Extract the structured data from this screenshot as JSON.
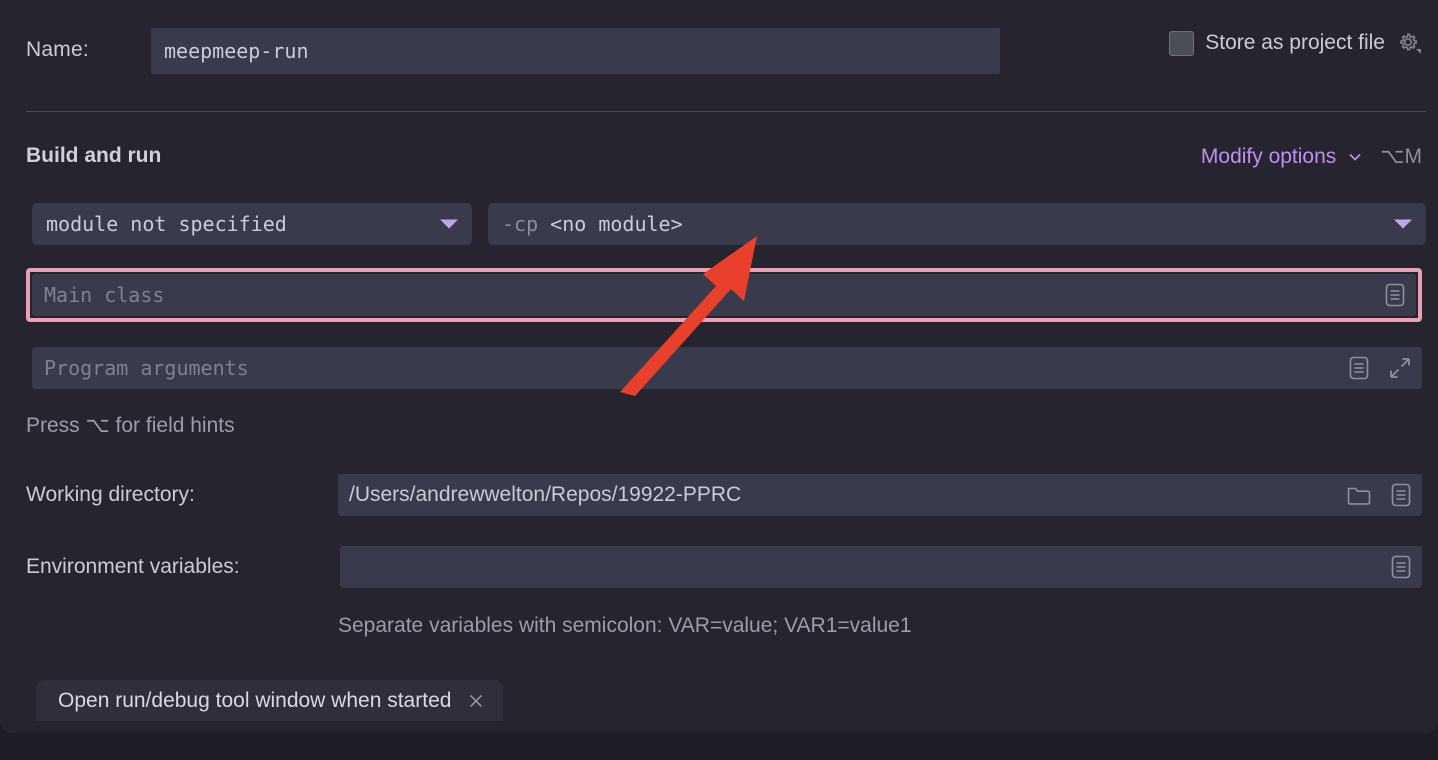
{
  "dialog": {
    "name_row": {
      "label": "Name:",
      "value": "meepmeep-run",
      "store_as_project_file_label": "Store as project file",
      "gear_icon": "gear-icon",
      "checkbox_checked": false
    },
    "section": {
      "title": "Build and run",
      "modify_options_label": "Modify options",
      "modify_options_shortcut": "⌥M",
      "chevron_icon": "chevron-down-icon"
    },
    "module_combo": {
      "value": "module not specified",
      "caret_icon": "caret-down-icon"
    },
    "classpath_combo": {
      "prefix": "-cp",
      "value": "<no module>",
      "caret_icon": "caret-down-icon"
    },
    "main_class": {
      "placeholder": "Main class",
      "value": "",
      "expand_icon": "document-lines-icon",
      "highlighted": true
    },
    "program_arguments": {
      "placeholder": "Program arguments",
      "value": "",
      "expand_icon": "document-lines-icon",
      "fullscreen_icon": "expand-diagonal-icon"
    },
    "field_hint": "Press ⌥ for field hints",
    "working_directory": {
      "label": "Working directory:",
      "value": "/Users/andrewwelton/Repos/19922-PPRC",
      "folder_icon": "folder-icon",
      "expand_icon": "document-lines-icon"
    },
    "environment_variables": {
      "label": "Environment variables:",
      "value": "",
      "expand_icon": "document-lines-icon",
      "hint": "Separate variables with semicolon: VAR=value; VAR1=value1"
    },
    "option_chip": {
      "label": "Open run/debug tool window when started",
      "close_icon": "close-icon"
    }
  },
  "annotation": {
    "arrow_icon": "red-arrow-pointer",
    "color": "#e8402a"
  },
  "colors": {
    "background": "#26252f",
    "field_background": "#393a4b",
    "accent_purple": "#c08ef0",
    "highlight_pink": "#eca0b6",
    "text_primary": "#c9ccd6",
    "text_muted": "#9a9dab"
  }
}
